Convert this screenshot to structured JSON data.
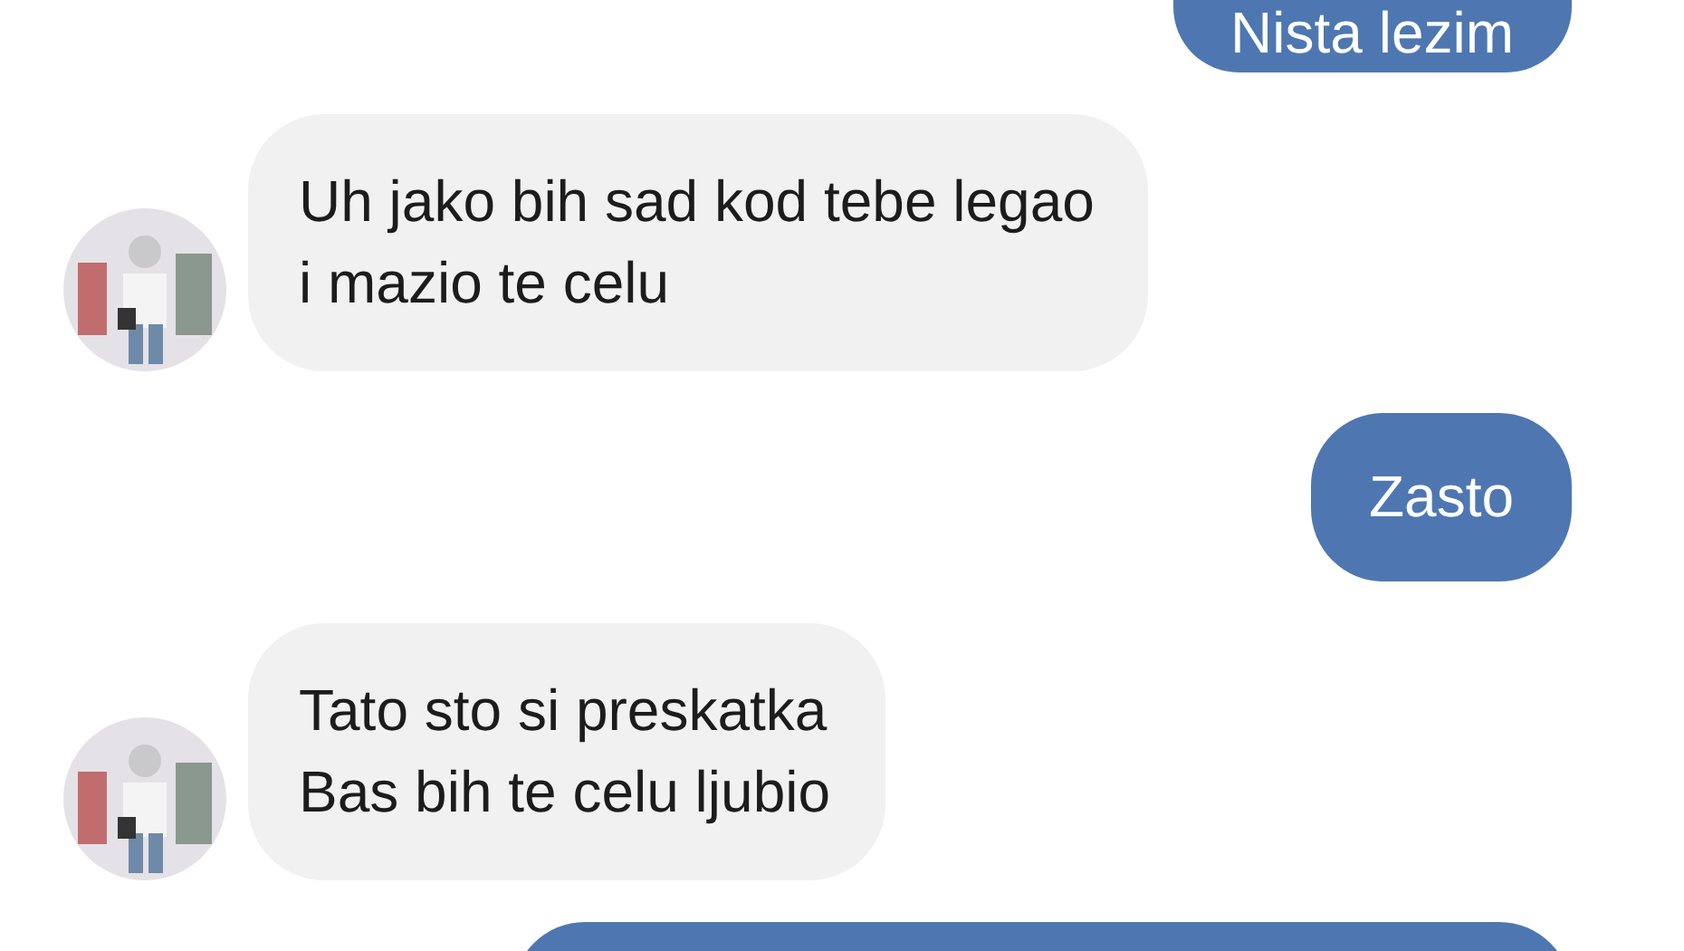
{
  "messages": [
    {
      "kind": "sent",
      "lines": [
        "Nista lezim"
      ]
    },
    {
      "kind": "received",
      "lines": [
        "Uh jako bih sad kod tebe legao",
        "i mazio te celu"
      ]
    },
    {
      "kind": "sent",
      "lines": [
        "Zasto"
      ]
    },
    {
      "kind": "received",
      "lines": [
        "Tato sto si preskatka",
        "Bas bih te celu ljubio"
      ]
    },
    {
      "kind": "sent"
    }
  ]
}
